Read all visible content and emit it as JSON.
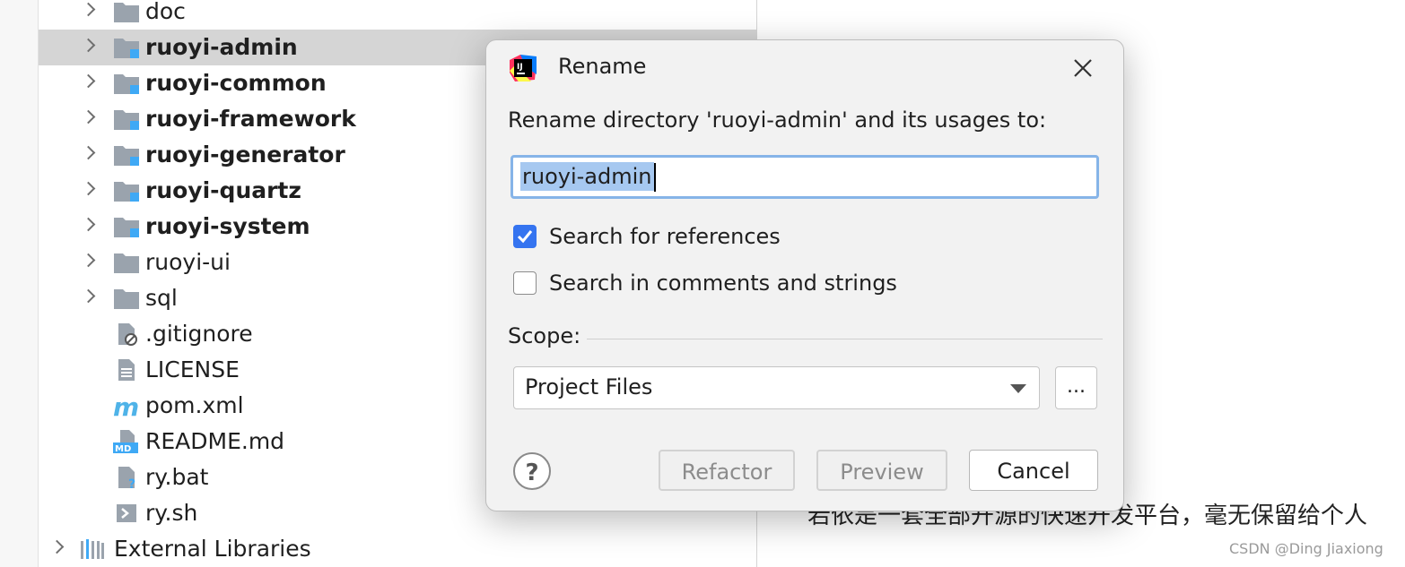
{
  "project_tree": {
    "items": [
      {
        "label": "doc",
        "type": "folder",
        "bold": false,
        "expandable": true
      },
      {
        "label": "ruoyi-admin",
        "type": "module",
        "bold": true,
        "expandable": true,
        "selected": true
      },
      {
        "label": "ruoyi-common",
        "type": "module",
        "bold": true,
        "expandable": true
      },
      {
        "label": "ruoyi-framework",
        "type": "module",
        "bold": true,
        "expandable": true
      },
      {
        "label": "ruoyi-generator",
        "type": "module",
        "bold": true,
        "expandable": true
      },
      {
        "label": "ruoyi-quartz",
        "type": "module",
        "bold": true,
        "expandable": true
      },
      {
        "label": "ruoyi-system",
        "type": "module",
        "bold": true,
        "expandable": true
      },
      {
        "label": "ruoyi-ui",
        "type": "folder",
        "bold": false,
        "expandable": true
      },
      {
        "label": "sql",
        "type": "folder",
        "bold": false,
        "expandable": true
      },
      {
        "label": ".gitignore",
        "type": "gitignore-file",
        "bold": false,
        "expandable": false
      },
      {
        "label": "LICENSE",
        "type": "text-file",
        "bold": false,
        "expandable": false
      },
      {
        "label": "pom.xml",
        "type": "maven-file",
        "bold": false,
        "expandable": false
      },
      {
        "label": "README.md",
        "type": "markdown-file",
        "bold": false,
        "expandable": false
      },
      {
        "label": "ry.bat",
        "type": "unknown-file",
        "bold": false,
        "expandable": false
      },
      {
        "label": "ry.sh",
        "type": "shell-file",
        "bold": false,
        "expandable": false
      }
    ],
    "external_libraries": "External Libraries"
  },
  "background_text": "若依是一套全部开源的快速开发平台，毫无保留给个人",
  "watermark": "CSDN @Ding Jiaxiong",
  "dialog": {
    "title": "Rename",
    "prompt": "Rename directory 'ruoyi-admin' and its usages to:",
    "name_value": "ruoyi-admin",
    "search_references_label": "Search for references",
    "search_references_checked": true,
    "search_comments_label": "Search in comments and strings",
    "search_comments_checked": false,
    "scope_label": "Scope:",
    "scope_value": "Project Files",
    "scope_more_label": "...",
    "help_label": "?",
    "refactor_label": "Refactor",
    "preview_label": "Preview",
    "cancel_label": "Cancel"
  },
  "colors": {
    "accent": "#3574f0",
    "selection": "#a6c8f0",
    "module_badge": "#3fa9f5",
    "folder_gray": "#9aa3ad"
  }
}
